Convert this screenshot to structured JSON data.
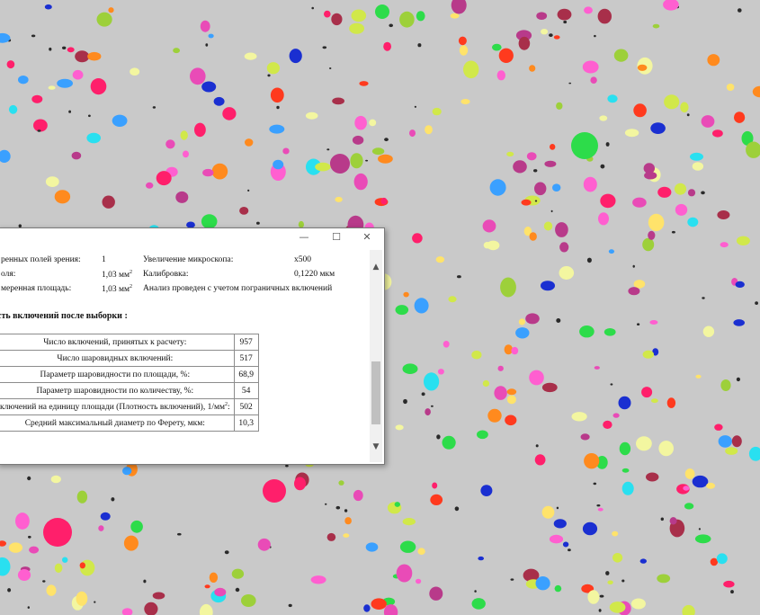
{
  "window": {
    "controls": {
      "minimize": "—",
      "maximize": "☐",
      "close": "✕"
    }
  },
  "info": {
    "fields_label": "ренных полей зрения:",
    "fields_value": "1",
    "area_label": "оля:",
    "area_value": "1,03 мм",
    "measured_label": "меренная площадь:",
    "measured_value": "1,03 мм",
    "magnification_label": "Увеличение микроскопа:",
    "magnification_value": "x500",
    "calibration_label": "Калибровка:",
    "calibration_value": "0,1220 мкм",
    "note": "Анализ проведен с учетом пограничных включений",
    "square_sup": "2"
  },
  "section_title": "сть включений после выборки :",
  "results": [
    {
      "label": "Число включений, принятых к расчету:",
      "value": "957"
    },
    {
      "label": "Число шаровидных включений:",
      "value": "517"
    },
    {
      "label": "Параметр шаровидности по площади, %:",
      "value": "68,9"
    },
    {
      "label": "Параметр шаровидности по количеству, %:",
      "value": "54"
    },
    {
      "label": "ключений на единицу площади (Плотность включений), 1/мм",
      "sup": "2",
      "suffix": ":",
      "value": "502"
    },
    {
      "label": "Средний максимальный диаметр по Ферету, мкм:",
      "value": "10,3"
    }
  ],
  "scrollbar": {
    "up": "▲",
    "down": "▼"
  },
  "colors": {
    "background": "#c9c9c9",
    "inclusion_palette": [
      "#ff1f6b",
      "#1a2fd1",
      "#ffe36b",
      "#2ddc4a",
      "#29e0f0",
      "#ff8a1e",
      "#ff5fd0",
      "#b83a8a",
      "#d1e84a",
      "#ff3a1e",
      "#3aa0ff",
      "#f3f6a0",
      "#a82f4a",
      "#9dd03a",
      "#e94bb7"
    ]
  }
}
